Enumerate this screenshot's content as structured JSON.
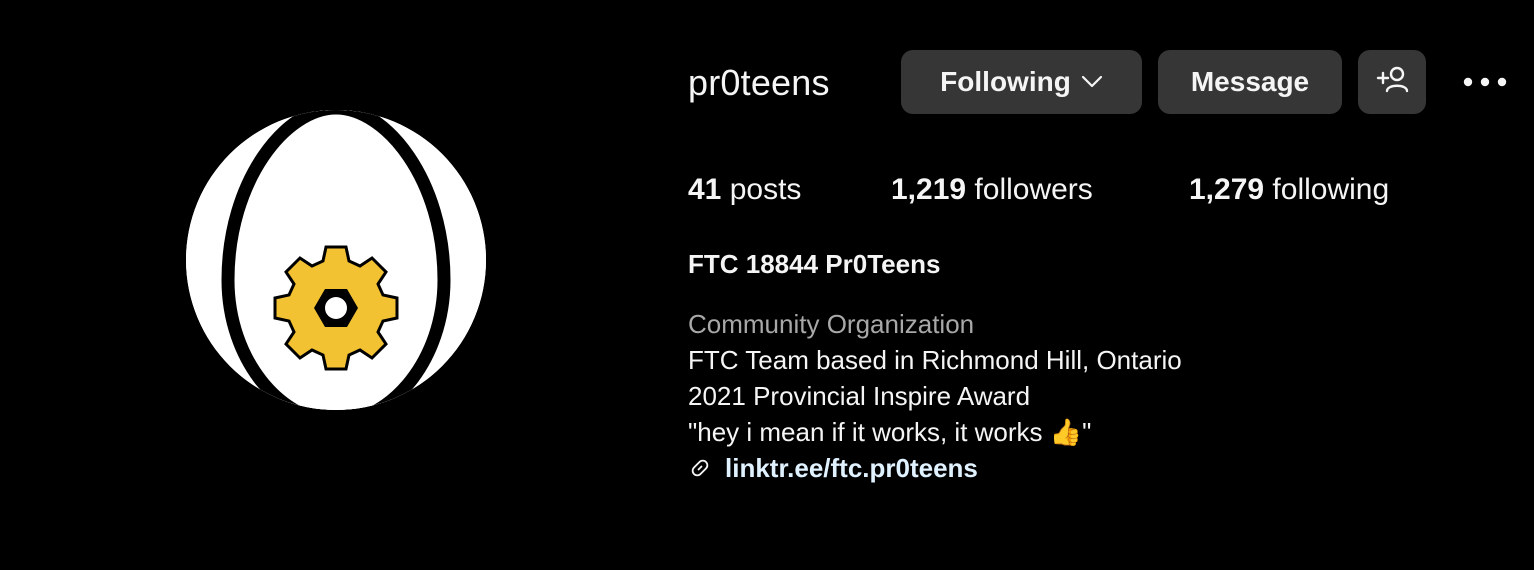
{
  "profile": {
    "username": "pr0teens",
    "full_name": "FTC 18844 Pr0Teens",
    "category": "Community Organization",
    "bio_lines": [
      "FTC Team based in Richmond Hill, Ontario",
      "2021 Provincial Inspire Award",
      "\"hey i mean if it works, it works 👍\""
    ],
    "link": "linktr.ee/ftc.pr0teens"
  },
  "actions": {
    "following_label": "Following",
    "message_label": "Message"
  },
  "stats": {
    "posts_count": "41",
    "posts_label": "posts",
    "followers_count": "1,219",
    "followers_label": "followers",
    "following_count": "1,279",
    "following_label": "following"
  },
  "icons": {
    "avatar": "egg-with-gear-logo",
    "following_dropdown": "chevron-down-icon",
    "add_user": "add-user-icon",
    "more": "more-options-icon",
    "link": "link-icon"
  },
  "colors": {
    "background": "#000000",
    "button_bg": "#363636",
    "text_primary": "#f5f5f5",
    "text_secondary": "#a8a8a8",
    "link": "#e0f1ff",
    "gear": "#f2c233"
  }
}
